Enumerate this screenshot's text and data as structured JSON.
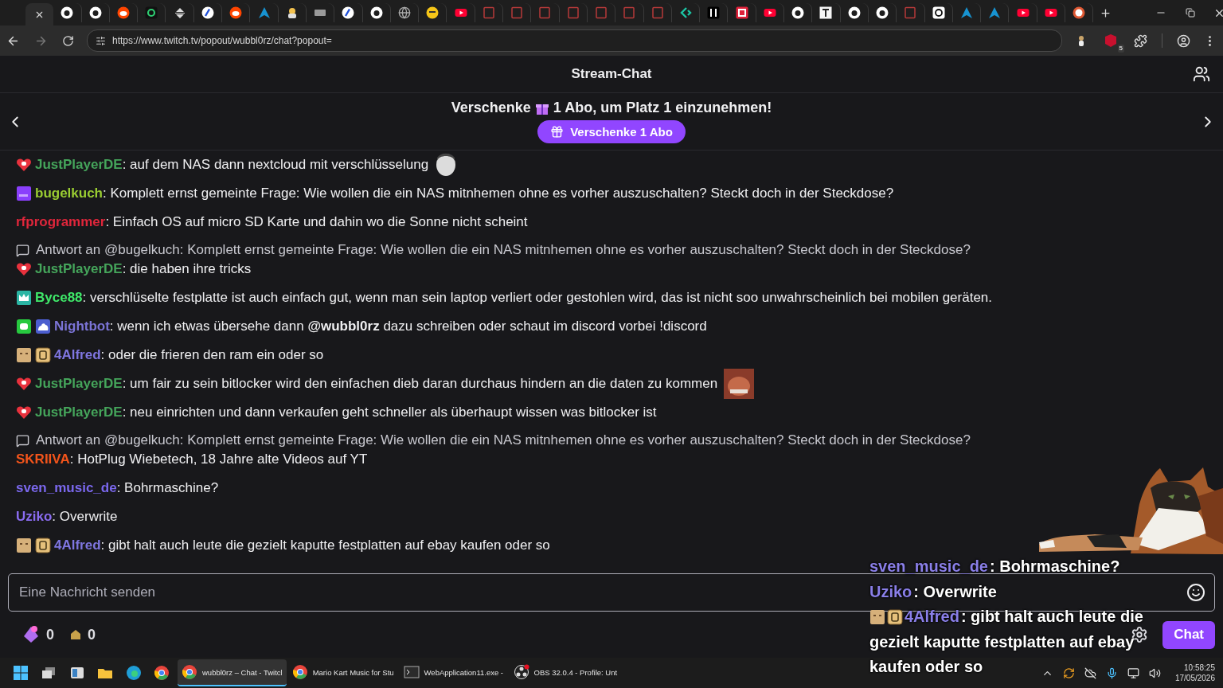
{
  "browser": {
    "tabs": [
      {
        "kind": "close",
        "selected": true
      },
      {
        "kind": "github",
        "selected": false
      },
      {
        "kind": "github",
        "selected": false
      },
      {
        "kind": "reddit",
        "selected": false
      },
      {
        "kind": "g",
        "selected": false
      },
      {
        "kind": "updown",
        "selected": false
      },
      {
        "kind": "slash",
        "selected": false
      },
      {
        "kind": "reddit",
        "selected": false
      },
      {
        "kind": "arch",
        "selected": false
      },
      {
        "kind": "cat",
        "selected": false
      },
      {
        "kind": "card",
        "selected": false
      },
      {
        "kind": "slash",
        "selected": false
      },
      {
        "kind": "github",
        "selected": false
      },
      {
        "kind": "globe",
        "selected": false
      },
      {
        "kind": "emoji",
        "selected": false
      },
      {
        "kind": "youtube",
        "selected": false
      },
      {
        "kind": "n",
        "selected": false
      },
      {
        "kind": "n",
        "selected": false
      },
      {
        "kind": "n",
        "selected": false
      },
      {
        "kind": "n",
        "selected": false
      },
      {
        "kind": "n",
        "selected": false
      },
      {
        "kind": "n",
        "selected": false
      },
      {
        "kind": "n",
        "selected": false
      },
      {
        "kind": "c",
        "selected": false
      },
      {
        "kind": "bars",
        "selected": false
      },
      {
        "kind": "h",
        "selected": false
      },
      {
        "kind": "youtube",
        "selected": false
      },
      {
        "kind": "github",
        "selected": false
      },
      {
        "kind": "t",
        "selected": false
      },
      {
        "kind": "github",
        "selected": false
      },
      {
        "kind": "github",
        "selected": false
      },
      {
        "kind": "n",
        "selected": false
      },
      {
        "kind": "threads",
        "selected": false
      },
      {
        "kind": "arch",
        "selected": false
      },
      {
        "kind": "arch",
        "selected": false
      },
      {
        "kind": "youtube",
        "selected": false
      },
      {
        "kind": "youtube",
        "selected": false
      },
      {
        "kind": "ddg",
        "selected": false
      }
    ],
    "url": "https://www.twitch.tv/popout/wubbl0rz/chat?popout=",
    "extension_badge": "5"
  },
  "page": {
    "header": {
      "title": "Stream-Chat"
    },
    "banner": {
      "text_before": "Verschenke",
      "text_after": "1 Abo, um Platz 1 einzunehmen!",
      "button": "Verschenke 1 Abo"
    },
    "messages": [
      {
        "badges": [
          {
            "kind": "heart"
          }
        ],
        "user": "JustPlayerDE",
        "color": "#45a55b",
        "text": ": auf dem NAS dann nextcloud mit verschlüsselung",
        "emote": {
          "kind": "face"
        }
      },
      {
        "badges": [
          {
            "kind": "purple"
          }
        ],
        "user": "bugelkuch",
        "color": "#9acd32",
        "text": ": Komplett ernst gemeinte Frage: Wie wollen die ein NAS mitnhemen ohne es vorher auszuschalten? Steckt doch in der Steckdose?"
      },
      {
        "user": "rfprogrammer",
        "color": "#e0263b",
        "text": ": Einfach OS auf micro SD Karte und dahin wo die Sonne nicht scheint"
      },
      {
        "badges": [
          {
            "kind": "heart"
          }
        ],
        "user": "JustPlayerDE",
        "color": "#45a55b",
        "text": ": die haben ihre tricks",
        "reply": "Antwort an @bugelkuch: Komplett ernst gemeinte Frage: Wie wollen die ein NAS mitnhemen ohne es vorher auszuschalten? Steckt doch in der Steckdose?"
      },
      {
        "badges": [
          {
            "kind": "crown"
          }
        ],
        "user": "Byce88",
        "color": "#3fe96a",
        "text": ": verschlüselte festplatte ist auch einfach gut, wenn man sein laptop verliert oder gestohlen wird, das ist nicht soo unwahrscheinlich bei mobilen geräten."
      },
      {
        "badges": [
          {
            "kind": "bot"
          },
          {
            "kind": "cloud"
          }
        ],
        "user": "Nightbot",
        "color": "#7b74d6",
        "text": ": wenn ich etwas übersehe dann **@wubbl0rz** dazu schreiben oder schaut im discord vorbei !discord"
      },
      {
        "badges": [
          {
            "kind": "box"
          },
          {
            "kind": "tier"
          }
        ],
        "user": "4Alfred",
        "color": "#7f76e0",
        "text": ": oder die frieren den ram ein oder so"
      },
      {
        "badges": [
          {
            "kind": "heart"
          }
        ],
        "user": "JustPlayerDE",
        "color": "#45a55b",
        "text": ": um fair zu sein bitlocker wird den einfachen dieb daran durchaus hindern an die daten zu kommen",
        "emote": {
          "kind": "wide"
        }
      },
      {
        "badges": [
          {
            "kind": "heart"
          }
        ],
        "user": "JustPlayerDE",
        "color": "#45a55b",
        "text": ": neu einrichten und dann verkaufen geht schneller als überhaupt wissen was bitlocker ist"
      },
      {
        "user": "SKRIIVA",
        "color": "#f2541b",
        "text": ": HotPlug Wiebetech, 18 Jahre alte Videos auf YT",
        "reply": "Antwort an @bugelkuch: Komplett ernst gemeinte Frage: Wie wollen die ein NAS mitnhemen ohne es vorher auszuschalten? Steckt doch in der Steckdose?"
      },
      {
        "user": "sven_music_de",
        "color": "#7b68ee",
        "text": ": Bohrmaschine?"
      },
      {
        "user": "Uziko",
        "color": "#8a6cf0",
        "text": ": Overwrite"
      },
      {
        "badges": [
          {
            "kind": "box"
          },
          {
            "kind": "tier"
          }
        ],
        "user": "4Alfred",
        "color": "#7f76e0",
        "text": ": gibt halt auch leute die gezielt kaputte festplatten auf ebay kaufen oder so"
      }
    ],
    "input": {
      "placeholder": "Eine Nachricht senden"
    },
    "bits": "0",
    "points": "0",
    "chat_button": "Chat"
  },
  "overlay": {
    "lines": [
      {
        "user": "sven_music_de",
        "color": "#8a7fe8",
        "text": ": Bohrmaschine?"
      },
      {
        "user": "Uziko",
        "color": "#8a7fe8",
        "text": ": Overwrite"
      },
      {
        "badges": [
          {
            "kind": "box"
          },
          {
            "kind": "tier"
          }
        ],
        "user": "4Alfred",
        "color": "#8a7fe8",
        "text": ": gibt halt auch leute die",
        "continuation": [
          "gezielt kaputte festplatten auf ebay",
          "kaufen oder so"
        ]
      }
    ]
  },
  "taskbar": {
    "pinned": [
      {
        "kind": "start"
      },
      {
        "kind": "taskview"
      },
      {
        "kind": "widgets"
      },
      {
        "kind": "explorer"
      },
      {
        "kind": "edge"
      },
      {
        "kind": "chrome"
      }
    ],
    "apps": [
      {
        "kind": "chrome",
        "label": "wubbl0rz – Chat - Twitcl",
        "selected": true
      },
      {
        "kind": "chrome",
        "label": "Mario Kart Music for Stu",
        "selected": false
      },
      {
        "kind": "terminal",
        "label": "WebApplication11.exe -",
        "selected": false
      },
      {
        "kind": "obs",
        "label": "OBS 32.0.4 - Profile: Unt",
        "selected": false
      }
    ],
    "time": "10:58:25",
    "date": "17/05/2026"
  }
}
